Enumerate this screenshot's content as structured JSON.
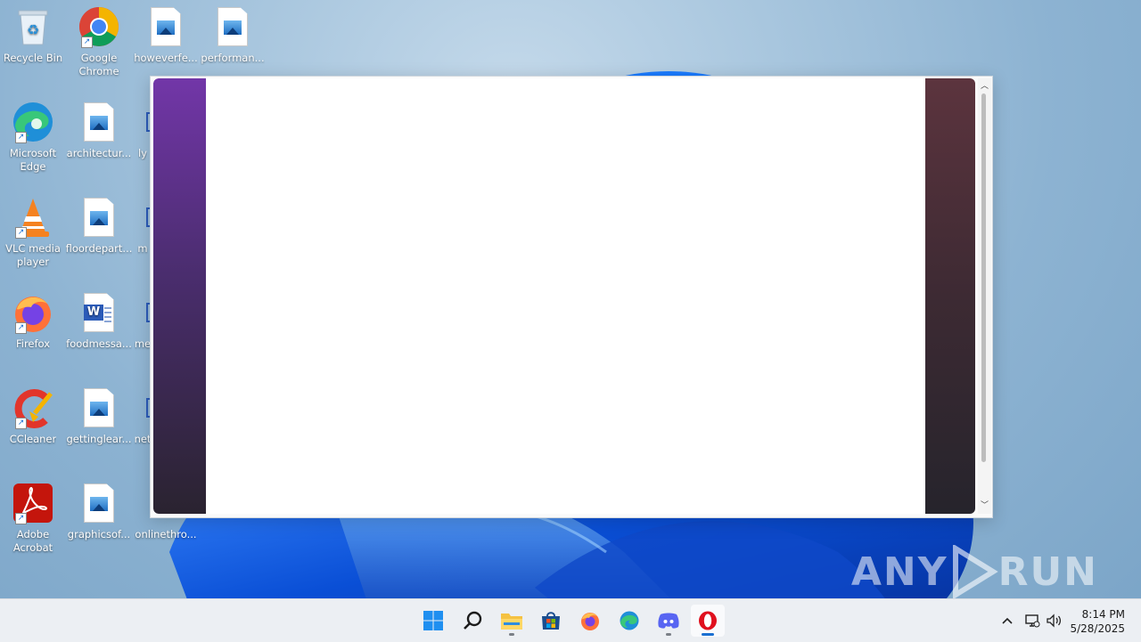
{
  "desktop": {
    "icons": [
      {
        "label": "Recycle Bin"
      },
      {
        "label": "Google Chrome"
      },
      {
        "label": "howeverfe..."
      },
      {
        "label": "performan..."
      },
      {
        "label": "Microsoft Edge"
      },
      {
        "label": "architectur..."
      },
      {
        "label": "ly"
      },
      {
        "label": "VLC media player"
      },
      {
        "label": "floordepart..."
      },
      {
        "label": "m"
      },
      {
        "label": "Firefox"
      },
      {
        "label": "foodmessa..."
      },
      {
        "label": "me"
      },
      {
        "label": "CCleaner"
      },
      {
        "label": "gettinglear..."
      },
      {
        "label": "net"
      },
      {
        "label": "Adobe Acrobat"
      },
      {
        "label": "graphicsof..."
      },
      {
        "label": "onlinethro..."
      }
    ]
  },
  "watermark": {
    "text_left": "ANY",
    "text_right": "RUN"
  },
  "taskbar": {
    "apps": [
      {
        "name": "Start"
      },
      {
        "name": "Search"
      },
      {
        "name": "File Explorer"
      },
      {
        "name": "Microsoft Store"
      },
      {
        "name": "Firefox"
      },
      {
        "name": "Microsoft Edge"
      },
      {
        "name": "Discord"
      },
      {
        "name": "Opera"
      }
    ],
    "clock": {
      "time": "8:14 PM",
      "date": "5/28/2025"
    }
  },
  "colors": {
    "accent": "#1a6fd1",
    "popup_left_band": "#7236a8",
    "popup_right_band": "#5c343e"
  }
}
